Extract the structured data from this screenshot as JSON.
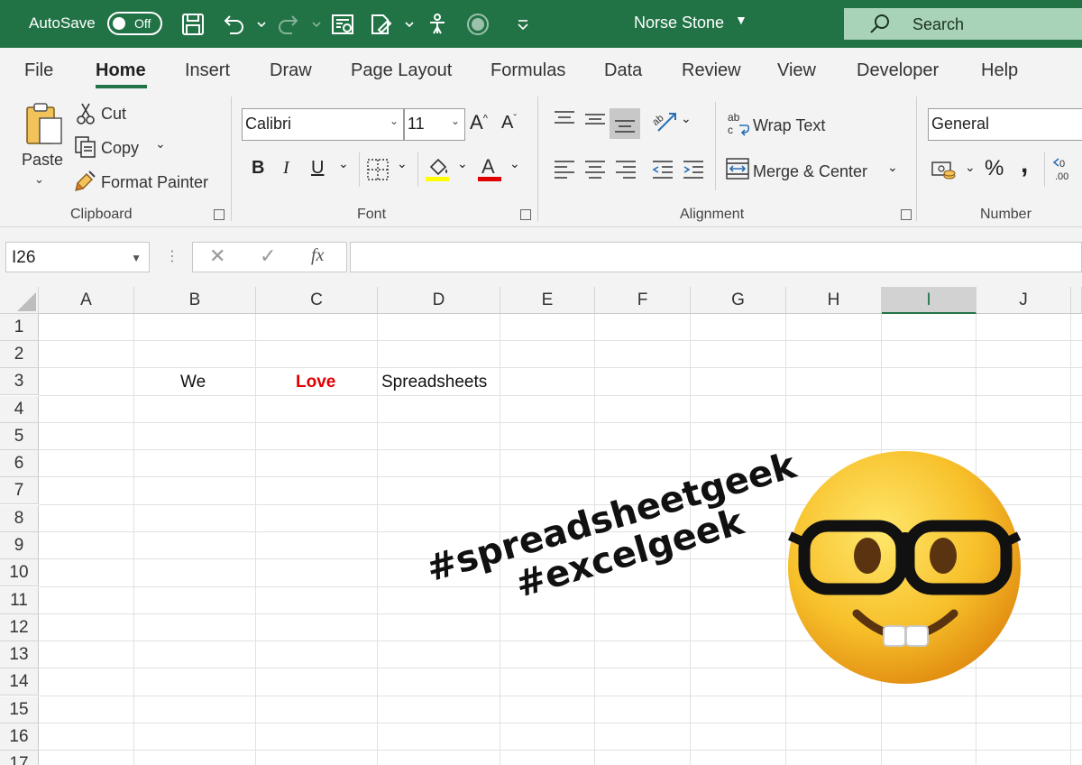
{
  "titlebar": {
    "autosave_label": "AutoSave",
    "autosave_state": "Off",
    "document_title": "Norse Stone",
    "search_placeholder": "Search",
    "accent_color": "#217346"
  },
  "tabs": [
    "File",
    "Home",
    "Insert",
    "Draw",
    "Page Layout",
    "Formulas",
    "Data",
    "Review",
    "View",
    "Developer",
    "Help"
  ],
  "active_tab": "Home",
  "ribbon": {
    "clipboard": {
      "paste": "Paste",
      "cut": "Cut",
      "copy": "Copy",
      "format_painter": "Format Painter",
      "group_label": "Clipboard"
    },
    "font": {
      "font_name": "Calibri",
      "font_size": "11",
      "bold": "B",
      "italic": "I",
      "underline": "U",
      "group_label": "Font",
      "fill_color": "#ffff00",
      "font_color": "#ff0000"
    },
    "alignment": {
      "wrap_text": "Wrap Text",
      "merge_center": "Merge & Center",
      "group_label": "Alignment"
    },
    "number": {
      "format": "General",
      "percent": "%",
      "comma": ",",
      "group_label": "Number"
    }
  },
  "formula_bar": {
    "name_box": "I26",
    "fx": "fx",
    "formula": ""
  },
  "sheet": {
    "columns": [
      "A",
      "B",
      "C",
      "D",
      "E",
      "F",
      "G",
      "H",
      "I",
      "J"
    ],
    "selected_column": "I",
    "rows": [
      "1",
      "2",
      "3",
      "4",
      "5",
      "6",
      "7",
      "8",
      "9",
      "10",
      "11",
      "12",
      "13",
      "14",
      "15",
      "16",
      "17"
    ],
    "cells": {
      "B3": "We",
      "C3": "Love",
      "D3": "Spreadsheets"
    },
    "love_color": "#e00000"
  },
  "overlay": {
    "hashtag1": "#spreadsheetgeek",
    "hashtag2": "#excelgeek",
    "emoji": "nerd-face"
  }
}
